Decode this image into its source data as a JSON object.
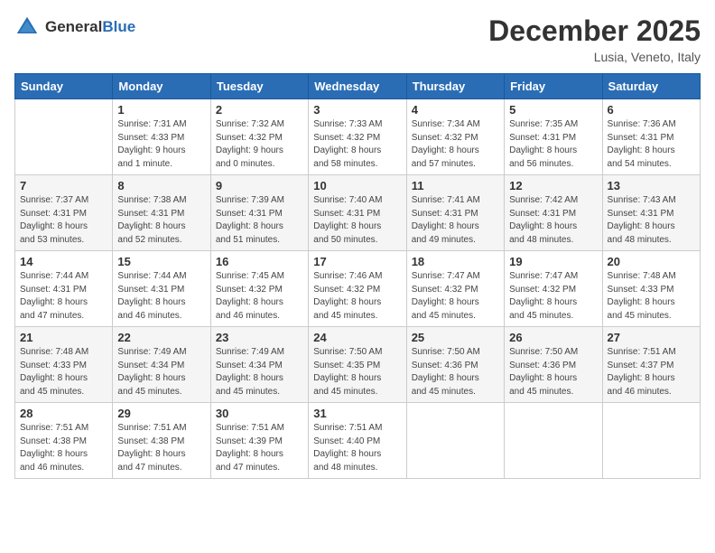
{
  "header": {
    "logo_general": "General",
    "logo_blue": "Blue",
    "month": "December 2025",
    "location": "Lusia, Veneto, Italy"
  },
  "weekdays": [
    "Sunday",
    "Monday",
    "Tuesday",
    "Wednesday",
    "Thursday",
    "Friday",
    "Saturday"
  ],
  "weeks": [
    [
      {
        "day": "",
        "info": ""
      },
      {
        "day": "1",
        "info": "Sunrise: 7:31 AM\nSunset: 4:33 PM\nDaylight: 9 hours\nand 1 minute."
      },
      {
        "day": "2",
        "info": "Sunrise: 7:32 AM\nSunset: 4:32 PM\nDaylight: 9 hours\nand 0 minutes."
      },
      {
        "day": "3",
        "info": "Sunrise: 7:33 AM\nSunset: 4:32 PM\nDaylight: 8 hours\nand 58 minutes."
      },
      {
        "day": "4",
        "info": "Sunrise: 7:34 AM\nSunset: 4:32 PM\nDaylight: 8 hours\nand 57 minutes."
      },
      {
        "day": "5",
        "info": "Sunrise: 7:35 AM\nSunset: 4:31 PM\nDaylight: 8 hours\nand 56 minutes."
      },
      {
        "day": "6",
        "info": "Sunrise: 7:36 AM\nSunset: 4:31 PM\nDaylight: 8 hours\nand 54 minutes."
      }
    ],
    [
      {
        "day": "7",
        "info": "Sunrise: 7:37 AM\nSunset: 4:31 PM\nDaylight: 8 hours\nand 53 minutes."
      },
      {
        "day": "8",
        "info": "Sunrise: 7:38 AM\nSunset: 4:31 PM\nDaylight: 8 hours\nand 52 minutes."
      },
      {
        "day": "9",
        "info": "Sunrise: 7:39 AM\nSunset: 4:31 PM\nDaylight: 8 hours\nand 51 minutes."
      },
      {
        "day": "10",
        "info": "Sunrise: 7:40 AM\nSunset: 4:31 PM\nDaylight: 8 hours\nand 50 minutes."
      },
      {
        "day": "11",
        "info": "Sunrise: 7:41 AM\nSunset: 4:31 PM\nDaylight: 8 hours\nand 49 minutes."
      },
      {
        "day": "12",
        "info": "Sunrise: 7:42 AM\nSunset: 4:31 PM\nDaylight: 8 hours\nand 48 minutes."
      },
      {
        "day": "13",
        "info": "Sunrise: 7:43 AM\nSunset: 4:31 PM\nDaylight: 8 hours\nand 48 minutes."
      }
    ],
    [
      {
        "day": "14",
        "info": "Sunrise: 7:44 AM\nSunset: 4:31 PM\nDaylight: 8 hours\nand 47 minutes."
      },
      {
        "day": "15",
        "info": "Sunrise: 7:44 AM\nSunset: 4:31 PM\nDaylight: 8 hours\nand 46 minutes."
      },
      {
        "day": "16",
        "info": "Sunrise: 7:45 AM\nSunset: 4:32 PM\nDaylight: 8 hours\nand 46 minutes."
      },
      {
        "day": "17",
        "info": "Sunrise: 7:46 AM\nSunset: 4:32 PM\nDaylight: 8 hours\nand 45 minutes."
      },
      {
        "day": "18",
        "info": "Sunrise: 7:47 AM\nSunset: 4:32 PM\nDaylight: 8 hours\nand 45 minutes."
      },
      {
        "day": "19",
        "info": "Sunrise: 7:47 AM\nSunset: 4:32 PM\nDaylight: 8 hours\nand 45 minutes."
      },
      {
        "day": "20",
        "info": "Sunrise: 7:48 AM\nSunset: 4:33 PM\nDaylight: 8 hours\nand 45 minutes."
      }
    ],
    [
      {
        "day": "21",
        "info": "Sunrise: 7:48 AM\nSunset: 4:33 PM\nDaylight: 8 hours\nand 45 minutes."
      },
      {
        "day": "22",
        "info": "Sunrise: 7:49 AM\nSunset: 4:34 PM\nDaylight: 8 hours\nand 45 minutes."
      },
      {
        "day": "23",
        "info": "Sunrise: 7:49 AM\nSunset: 4:34 PM\nDaylight: 8 hours\nand 45 minutes."
      },
      {
        "day": "24",
        "info": "Sunrise: 7:50 AM\nSunset: 4:35 PM\nDaylight: 8 hours\nand 45 minutes."
      },
      {
        "day": "25",
        "info": "Sunrise: 7:50 AM\nSunset: 4:36 PM\nDaylight: 8 hours\nand 45 minutes."
      },
      {
        "day": "26",
        "info": "Sunrise: 7:50 AM\nSunset: 4:36 PM\nDaylight: 8 hours\nand 45 minutes."
      },
      {
        "day": "27",
        "info": "Sunrise: 7:51 AM\nSunset: 4:37 PM\nDaylight: 8 hours\nand 46 minutes."
      }
    ],
    [
      {
        "day": "28",
        "info": "Sunrise: 7:51 AM\nSunset: 4:38 PM\nDaylight: 8 hours\nand 46 minutes."
      },
      {
        "day": "29",
        "info": "Sunrise: 7:51 AM\nSunset: 4:38 PM\nDaylight: 8 hours\nand 47 minutes."
      },
      {
        "day": "30",
        "info": "Sunrise: 7:51 AM\nSunset: 4:39 PM\nDaylight: 8 hours\nand 47 minutes."
      },
      {
        "day": "31",
        "info": "Sunrise: 7:51 AM\nSunset: 4:40 PM\nDaylight: 8 hours\nand 48 minutes."
      },
      {
        "day": "",
        "info": ""
      },
      {
        "day": "",
        "info": ""
      },
      {
        "day": "",
        "info": ""
      }
    ]
  ]
}
